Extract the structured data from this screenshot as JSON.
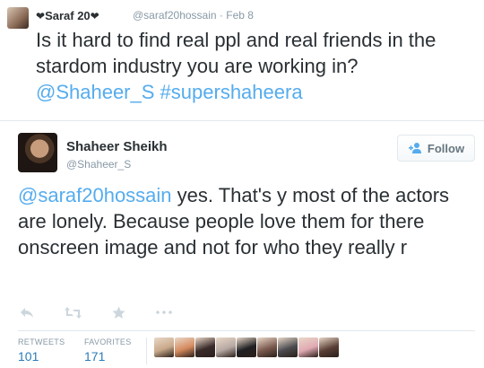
{
  "parent_tweet": {
    "display_name": "Saraf  20",
    "handle": "@saraf20hossain",
    "separator": "·",
    "date": "Feb 8",
    "text": "Is it hard to find real ppl and real friends in the stardom industry you are working in? ",
    "mention": "@Shaheer_S",
    "hashtag": "#supershaheera"
  },
  "main_tweet": {
    "display_name": "Shaheer Sheikh",
    "handle": "@Shaheer_S",
    "follow_label": "Follow",
    "mention": "@saraf20hossain",
    "text": " yes. That's y most of the actors are lonely. Because people love them for there onscreen image and not for who they really r",
    "actions": [
      "reply-icon",
      "retweet-icon",
      "favorite-icon",
      "more-icon"
    ],
    "stats": {
      "retweets_label": "RETWEETS",
      "retweets": "101",
      "favorites_label": "FAVORITES",
      "favorites": "171"
    },
    "favoriter_avatars": [
      {
        "icon": "avatar-1",
        "color": "#c9a98a"
      },
      {
        "icon": "avatar-2",
        "color": "#d58a5e"
      },
      {
        "icon": "avatar-3",
        "color": "#3a2b2b"
      },
      {
        "icon": "avatar-4",
        "color": "#b7a9a3"
      },
      {
        "icon": "avatar-5",
        "color": "#1f1f23"
      },
      {
        "icon": "avatar-6",
        "color": "#7b5a4e"
      },
      {
        "icon": "avatar-7",
        "color": "#4b4b4f"
      },
      {
        "icon": "avatar-8",
        "color": "#e0aab3"
      },
      {
        "icon": "avatar-9",
        "color": "#5a3f36"
      }
    ]
  },
  "colors": {
    "link": "#55acee",
    "stat_value": "#2b7bb9",
    "muted": "#8899a6",
    "text": "#292f33"
  }
}
